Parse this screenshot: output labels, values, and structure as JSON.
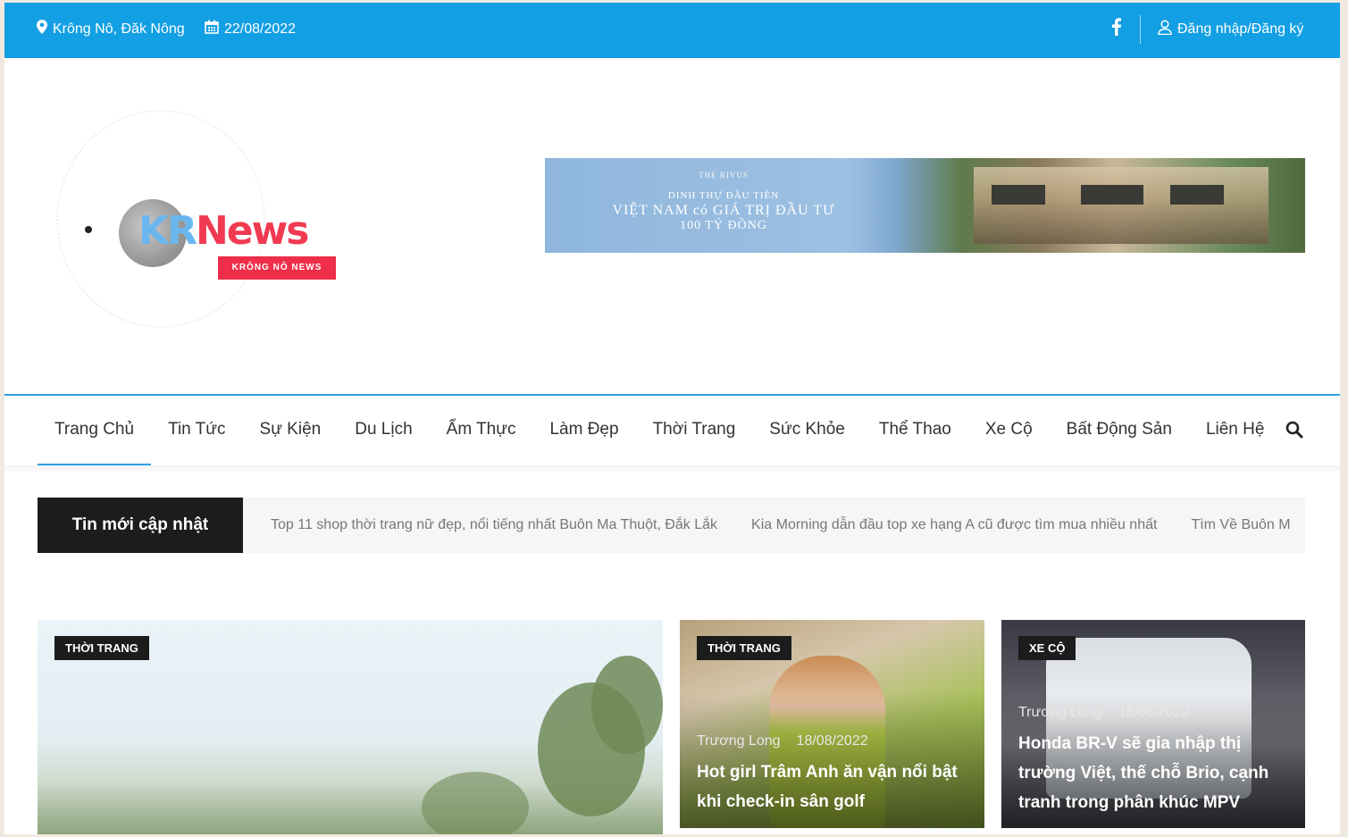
{
  "topbar": {
    "location": "Krông Nô, Đăk Nông",
    "date": "22/08/2022",
    "facebook_icon": "facebook-icon",
    "login": "Đăng nhập/Đăng ký"
  },
  "header": {
    "logo": {
      "kr": "KR",
      "news": "News",
      "subtitle": "KRÔNG NÔ NEWS"
    },
    "banner": {
      "brand": "THE RIVUS",
      "line1": "DINH THỰ ĐẦU TIÊN",
      "line2": "VIỆT NAM có GIÁ TRỊ ĐẦU TƯ",
      "line3": "100 TỶ ĐỒNG"
    }
  },
  "nav": {
    "items": [
      {
        "label": "Trang Chủ",
        "active": true
      },
      {
        "label": "Tin Tức"
      },
      {
        "label": "Sự Kiện"
      },
      {
        "label": "Du Lịch"
      },
      {
        "label": "Ẩm Thực"
      },
      {
        "label": "Làm Đẹp"
      },
      {
        "label": "Thời Trang"
      },
      {
        "label": "Sức Khỏe"
      },
      {
        "label": "Thể Thao"
      },
      {
        "label": "Xe Cộ"
      },
      {
        "label": "Bất Động Sản"
      },
      {
        "label": "Liên Hệ"
      }
    ],
    "search_icon": "search-icon"
  },
  "ticker": {
    "label": "Tin mới cập nhật",
    "items": [
      "Top 11 shop thời trang nữ đẹp, nổi tiếng nhất Buôn Ma Thuột, Đắk Lắk",
      "Kia Morning dẫn đầu top xe hạng A cũ được tìm mua nhiều nhất",
      "Tìm Về Buôn M"
    ]
  },
  "cards": [
    {
      "tag": "THỜI TRANG"
    },
    {
      "tag": "THỜI TRANG",
      "author": "Trương Long",
      "date": "18/08/2022",
      "title": "Hot girl Trâm Anh ăn vận nổi bật khi check-in sân golf"
    },
    {
      "tag": "XE CỘ",
      "author": "Trương Long",
      "date": "18/08/2022",
      "title": "Honda BR-V sẽ gia nhập thị trường Việt, thế chỗ Brio, cạnh tranh trong phân khúc MPV"
    }
  ],
  "colors": {
    "topbar": "#139fe3",
    "accent": "#2c9fe0",
    "tag_bg": "#1c1c1c",
    "logo_red": "#ef2e4a",
    "logo_blue": "#6ab7ef"
  }
}
